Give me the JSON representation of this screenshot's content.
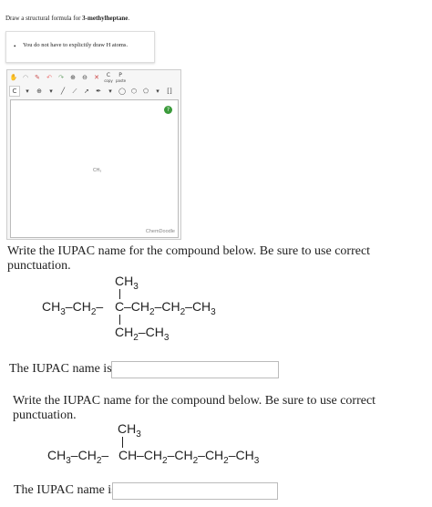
{
  "question1": {
    "prefix": "Draw a structural formula for ",
    "compound": "3-methylheptane",
    "suffix": ".",
    "note": "You do not have to explicitly draw H atoms."
  },
  "editor": {
    "toolbar_row1": [
      "hand-icon",
      "chain-icon",
      "eraser-icon",
      "undo-icon",
      "redo-icon",
      "zoom-in-icon",
      "zoom-out-icon",
      "C",
      "P"
    ],
    "toolbar_row1_sub": [
      "copy",
      "paste"
    ],
    "atom_selector": "C",
    "canvas_label": "CH₃",
    "brand": "ChemDoodle"
  },
  "question2": {
    "prompt": "Write the IUPAC name for the compound below. Be sure to use correct punctuation.",
    "answer_label": "The IUPAC name is",
    "answer_value": "",
    "structure": {
      "top": "CH3",
      "main_left": "CH3–CH2–",
      "center": "C",
      "main_right": "–CH2–CH2–CH3",
      "bottom": "CH2–CH3"
    }
  },
  "question3": {
    "prompt": "Write the IUPAC name for the compound below. Be sure to use correct punctuation.",
    "answer_label": "The IUPAC name is",
    "answer_value": "",
    "structure": {
      "top": "CH3",
      "main_left": "CH3–CH2–",
      "center": "CH",
      "main_right": "–CH2–CH2–CH2–CH3"
    }
  }
}
